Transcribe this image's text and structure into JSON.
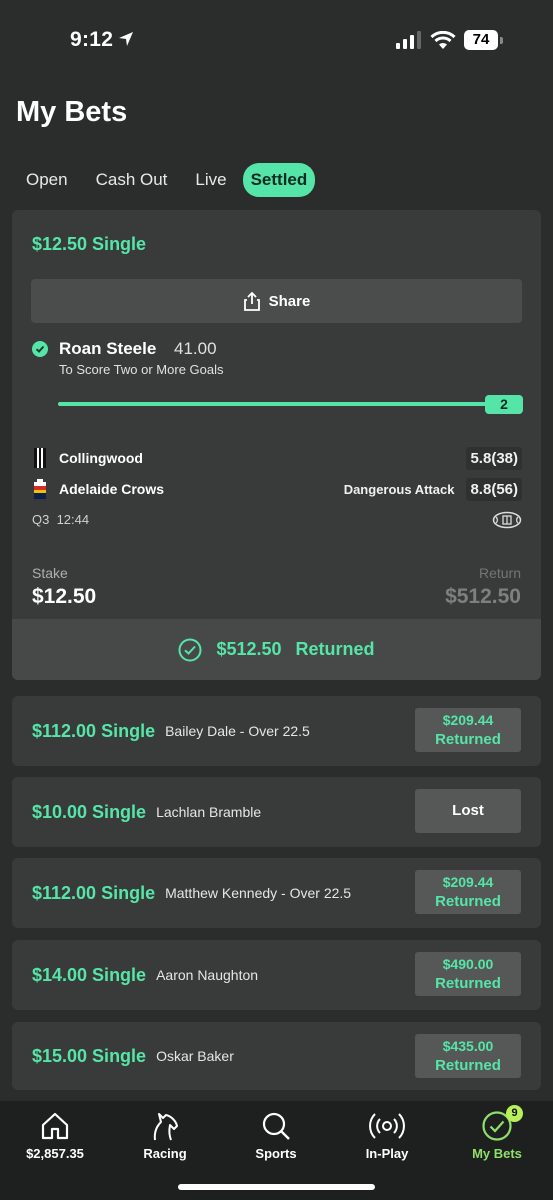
{
  "status_bar": {
    "time": "9:12",
    "battery": "74"
  },
  "page": {
    "title": "My Bets"
  },
  "tabs": [
    {
      "label": "Open"
    },
    {
      "label": "Cash Out"
    },
    {
      "label": "Live"
    },
    {
      "label": "Settled",
      "active": true
    }
  ],
  "main_bet": {
    "title": "$12.50 Single",
    "share_label": "Share",
    "selection": {
      "name": "Roan Steele",
      "odds": "41.00",
      "market": "To Score Two or More Goals"
    },
    "progress": {
      "value": "2",
      "fraction": 1.0
    },
    "teams": [
      {
        "name": "Collingwood",
        "status": "",
        "score": "5.8(38)"
      },
      {
        "name": "Adelaide Crows",
        "status": "Dangerous Attack",
        "score": "8.8(56)"
      }
    ],
    "game_clock": "Q3  12:44",
    "stake_label": "Stake",
    "stake_value": "$12.50",
    "return_label": "Return",
    "return_value": "$512.50",
    "returned_amount": "$512.50",
    "returned_label": "Returned"
  },
  "bets": [
    {
      "title": "$112.00 Single",
      "desc": "Bailey Dale - Over 22.5",
      "amount": "$209.44",
      "result": "Returned"
    },
    {
      "title": "$10.00 Single",
      "desc": "Lachlan Bramble",
      "amount": "",
      "result": "Lost"
    },
    {
      "title": "$112.00 Single",
      "desc": "Matthew Kennedy - Over 22.5",
      "amount": "$209.44",
      "result": "Returned"
    },
    {
      "title": "$14.00 Single",
      "desc": "Aaron Naughton",
      "amount": "$490.00",
      "result": "Returned"
    },
    {
      "title": "$15.00 Single",
      "desc": "Oskar Baker",
      "amount": "$435.00",
      "result": "Returned"
    }
  ],
  "nav": {
    "balance": "$2,857.35",
    "racing": "Racing",
    "sports": "Sports",
    "inplay": "In-Play",
    "mybets": "My Bets",
    "mybets_badge": "9"
  },
  "colors": {
    "accent": "#56e5a8",
    "nav_active": "#8ee06a",
    "background": "#2b2d2c",
    "card": "#383b3a"
  }
}
